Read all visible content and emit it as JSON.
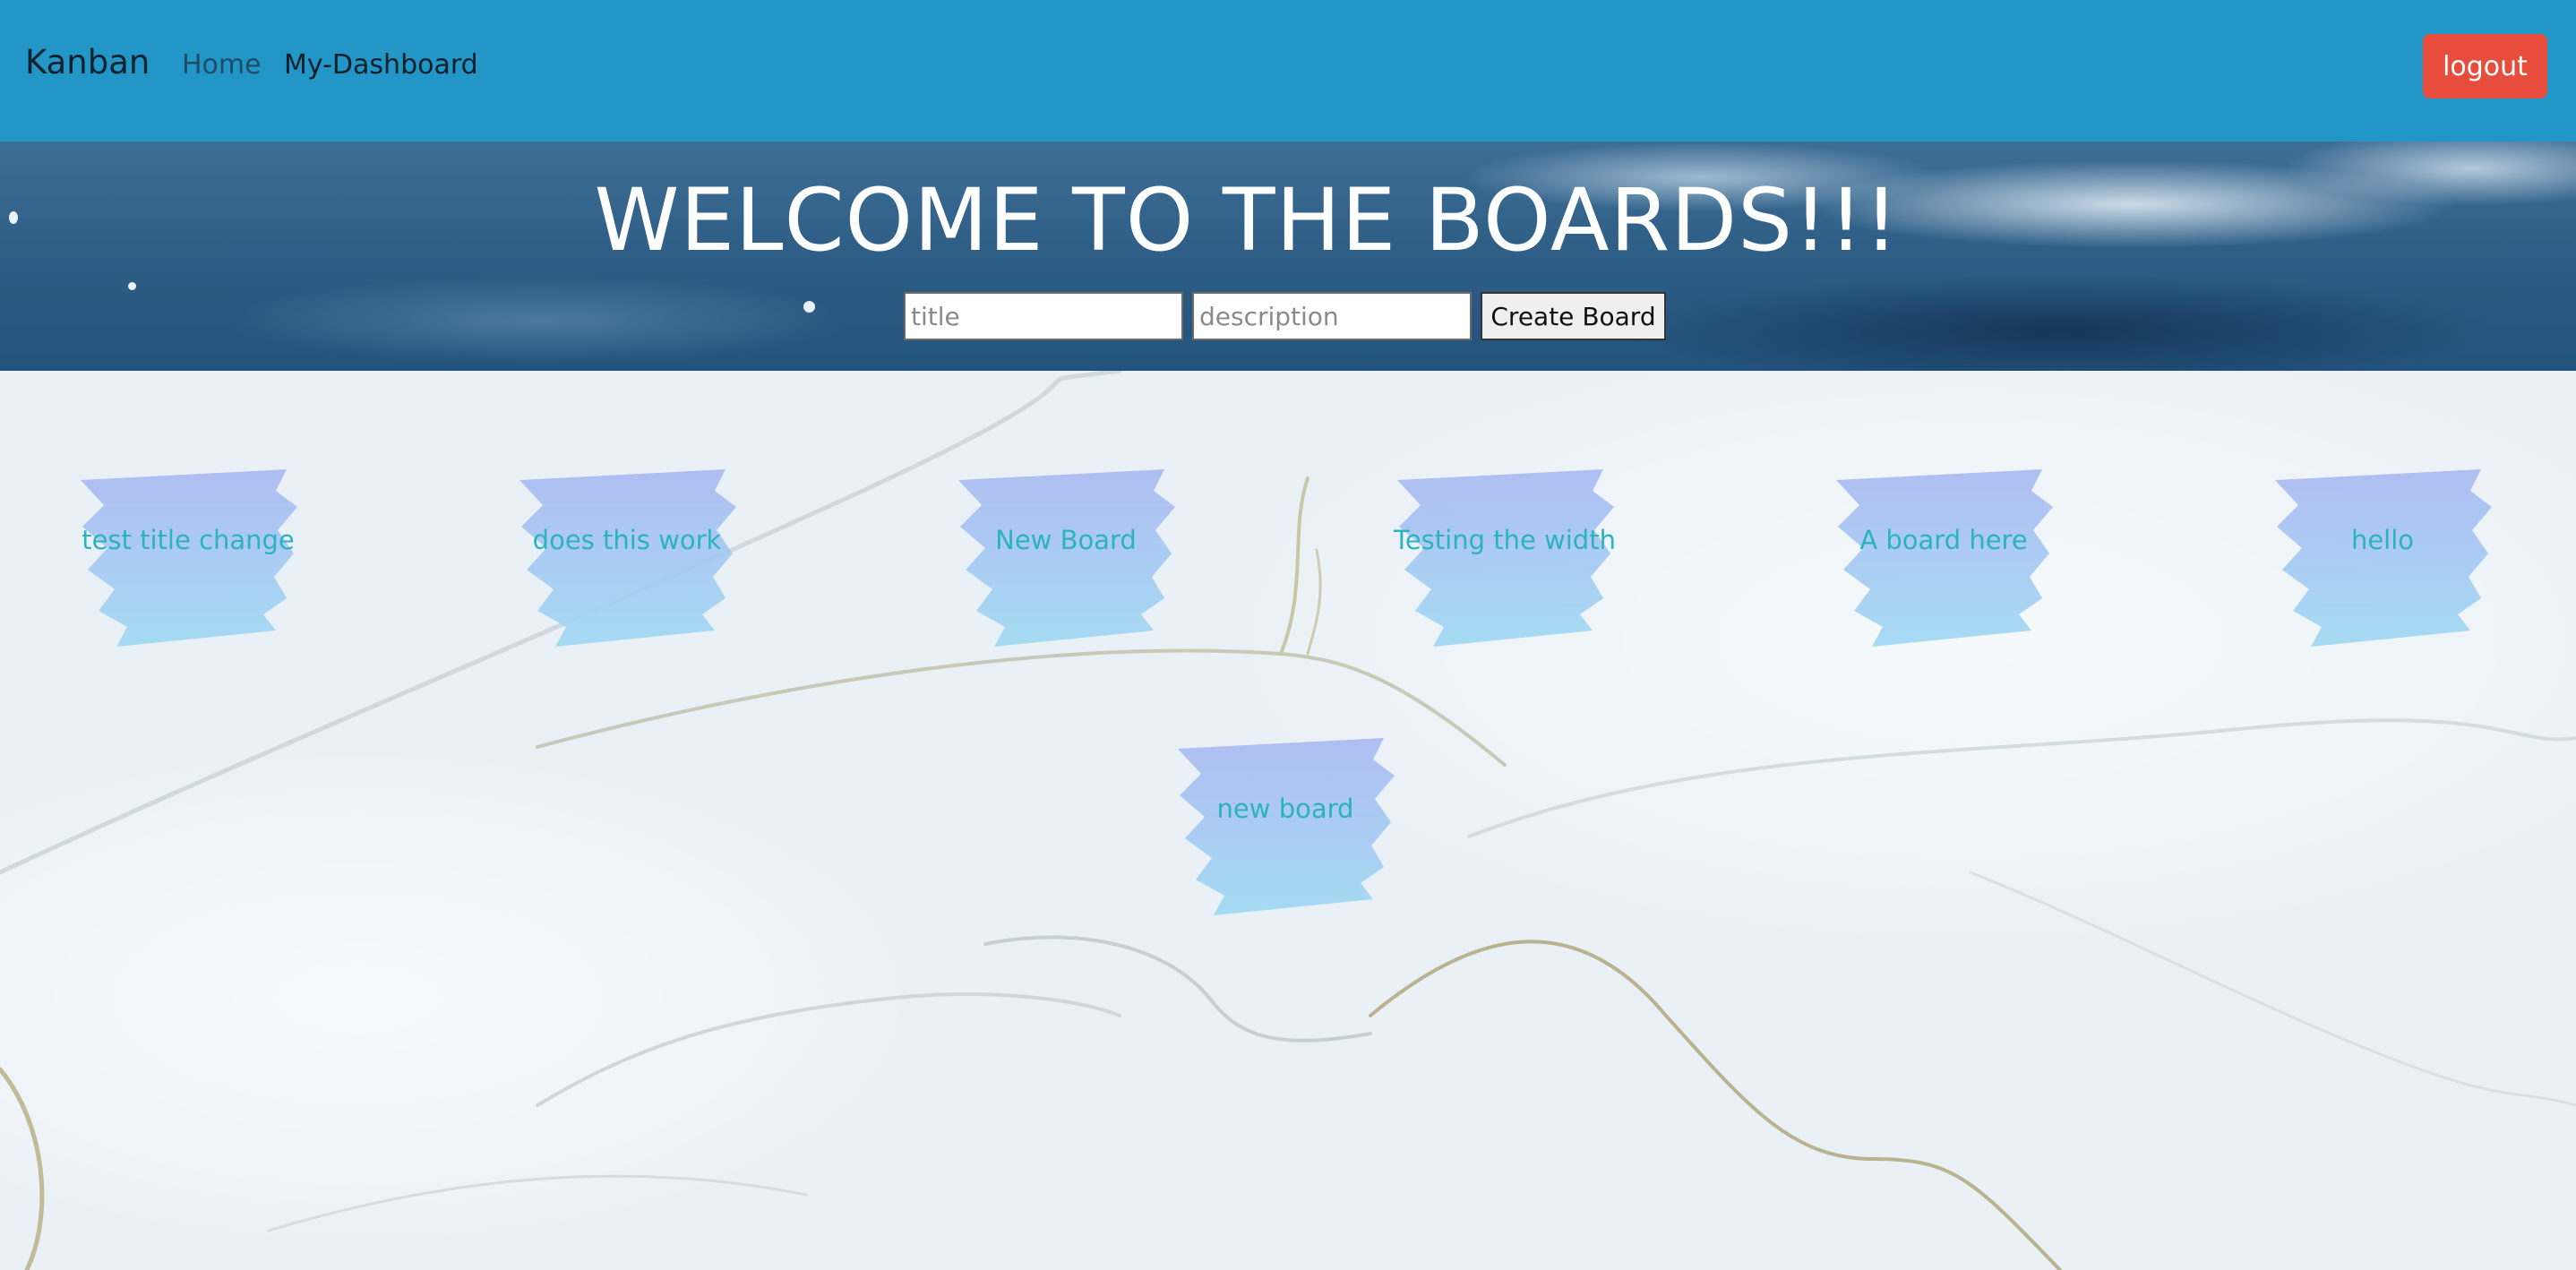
{
  "navbar": {
    "brand": "Kanban",
    "links": [
      {
        "label": "Home"
      },
      {
        "label": "My-Dashboard"
      }
    ],
    "logout_label": "logout"
  },
  "hero": {
    "title": "WELCOME TO THE BOARDS!!!",
    "form": {
      "title_placeholder": "title",
      "description_placeholder": "description",
      "create_label": "Create Board"
    }
  },
  "boards": [
    {
      "title": "test title change"
    },
    {
      "title": "does this work"
    },
    {
      "title": "New Board"
    },
    {
      "title": "Testing the width"
    },
    {
      "title": "A board here"
    },
    {
      "title": "hello"
    },
    {
      "title": "new board"
    }
  ],
  "colors": {
    "navbar": "#2196c7",
    "logout": "#e74c3c",
    "board_text": "#2bb3c0",
    "brush_top": "#a9b8f2",
    "brush_bottom": "#9ed8f3"
  }
}
